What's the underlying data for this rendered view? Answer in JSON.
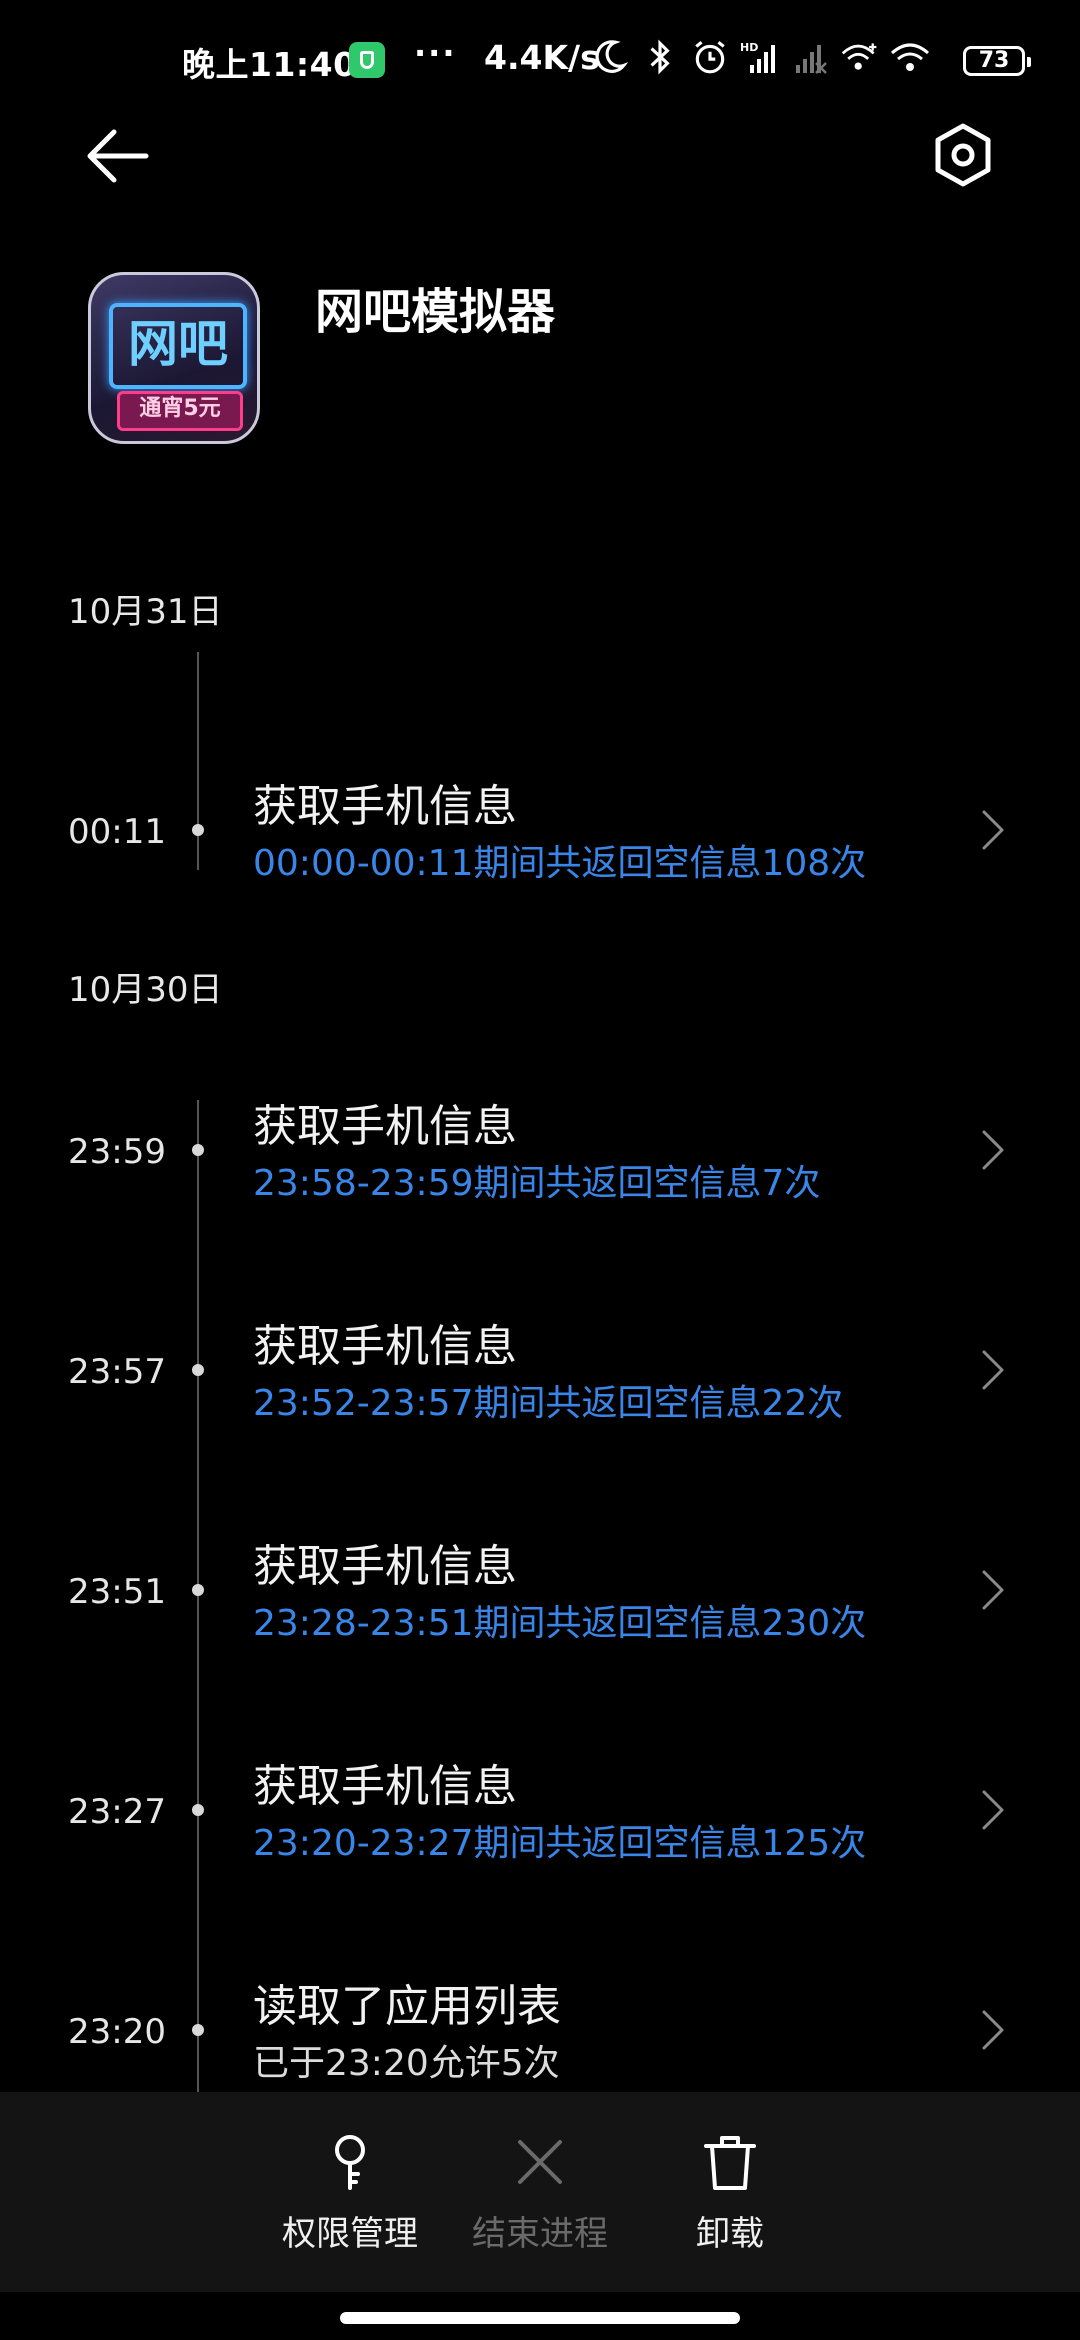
{
  "status_bar": {
    "time": "晚上11:40",
    "dots": "···",
    "net_speed": "4.4K/s",
    "battery": "73",
    "icons": [
      "shield-icon",
      "moon-icon",
      "bluetooth-icon",
      "alarm-icon",
      "hd-signal-icon",
      "no-signal-icon",
      "wifi-plus-icon",
      "wifi-icon",
      "battery-icon"
    ]
  },
  "header": {
    "back_icon": "back-arrow-icon",
    "settings_icon": "settings-hexagon-icon"
  },
  "app": {
    "name": "网吧模拟器",
    "icon_text_main": "网吧",
    "icon_text_tag": "通宵5元"
  },
  "timeline": {
    "groups": [
      {
        "date": "10月31日",
        "entries": [
          {
            "time": "00:11",
            "title": "获取手机信息",
            "detail": "00:00-00:11期间共返回空信息108次",
            "highlight": true
          }
        ]
      },
      {
        "date": "10月30日",
        "entries": [
          {
            "time": "23:59",
            "title": "获取手机信息",
            "detail": "23:58-23:59期间共返回空信息7次",
            "highlight": true
          },
          {
            "time": "23:57",
            "title": "获取手机信息",
            "detail": "23:52-23:57期间共返回空信息22次",
            "highlight": true
          },
          {
            "time": "23:51",
            "title": "获取手机信息",
            "detail": "23:28-23:51期间共返回空信息230次",
            "highlight": true
          },
          {
            "time": "23:27",
            "title": "获取手机信息",
            "detail": "23:20-23:27期间共返回空信息125次",
            "highlight": true
          },
          {
            "time": "23:20",
            "title": "读取了应用列表",
            "detail": "已于23:20允许5次",
            "highlight": false
          }
        ]
      }
    ]
  },
  "bottom_bar": {
    "permissions_label": "权限管理",
    "end_process_label": "结束进程",
    "uninstall_label": "卸载"
  },
  "colors": {
    "background": "#000000",
    "accent_blue": "#3a86e8",
    "bottom_bar": "#141414",
    "disabled_text": "#6a6a6a"
  }
}
